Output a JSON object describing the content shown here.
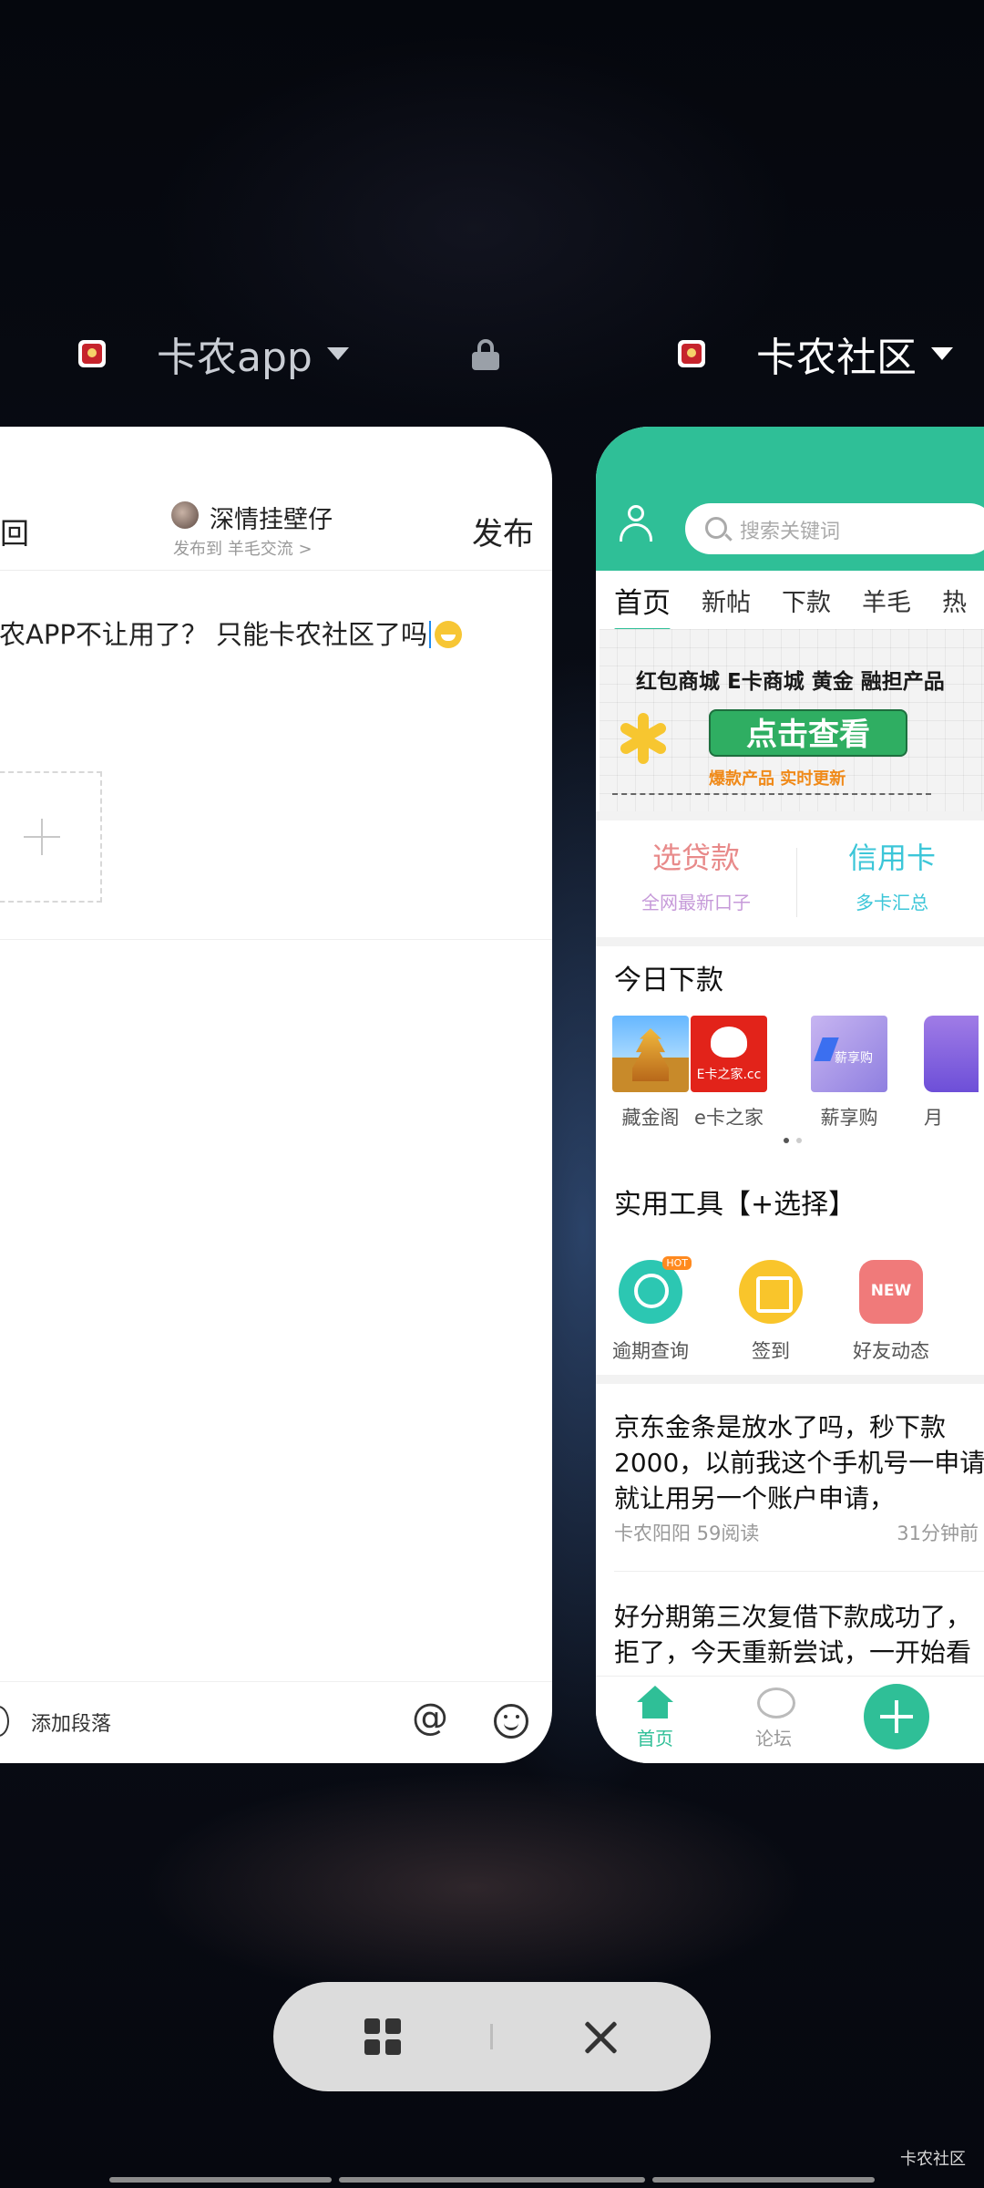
{
  "recents": {
    "left_app": {
      "name": "卡农app",
      "locked": true
    },
    "right_app": {
      "name": "卡农社区"
    }
  },
  "left_card": {
    "back_label": "返回",
    "author_name": "深情挂壁仔",
    "publish_to": "发布到 羊毛交流 >",
    "publish_button": "发布",
    "post_text": "卡农APP不让用了？ 只能卡农社区了吗",
    "toolbar": {
      "add_paragraph": "添加段落",
      "mention_symbol": "@"
    }
  },
  "right_card": {
    "search_placeholder": "搜索关键词",
    "tabs": [
      "首页",
      "新帖",
      "下款",
      "羊毛",
      "热"
    ],
    "active_tab": "首页",
    "banner": {
      "line1": "红包商城 E卡商城 黄金 融担产品",
      "button": "点击查看",
      "sub": "爆款产品 实时更新"
    },
    "loans": {
      "left_title": "选贷款",
      "left_sub": "全网最新口子",
      "right_title": "信用卡",
      "right_sub": "多卡汇总"
    },
    "today_title": "今日下款",
    "apps": [
      {
        "name": "藏金阁",
        "icon": "pagoda-icon"
      },
      {
        "name": "e卡之家",
        "icon": "ecard-icon",
        "icon_text": "E卡之家.cc"
      },
      {
        "name": "薪享购",
        "icon": "xinxianggou-icon",
        "icon_text": "薪享购"
      },
      {
        "name": "月",
        "icon": "partial-app-icon"
      }
    ],
    "tools_title": "实用工具【+选择】",
    "tools": [
      {
        "name": "逾期查询",
        "icon": "overdue-search-icon",
        "badge": "HOT"
      },
      {
        "name": "签到",
        "icon": "checkin-calendar-icon"
      },
      {
        "name": "好友动态",
        "icon": "new-friends-icon",
        "badge": "NEW"
      }
    ],
    "news": [
      {
        "title": "京东金条是放水了吗，秒下款2000，以前我这个手机号一申请就让用另一个账户申请，",
        "author_reads": "卡农阳阳 59阅读",
        "time": "31分钟前"
      },
      {
        "title": "好分期第三次复借下款成功了，拒了，今天重新尝试，一开始看"
      }
    ],
    "bottom_nav": [
      {
        "label": "首页",
        "icon": "home-icon",
        "active": true
      },
      {
        "label": "论坛",
        "icon": "forum-icon",
        "active": false
      }
    ]
  },
  "controls": {
    "grid_icon": "grid-icon",
    "close_icon": "close-icon"
  },
  "watermark": "卡农社区",
  "colors": {
    "brand_green": "#2fbf97",
    "background": "#060912"
  }
}
